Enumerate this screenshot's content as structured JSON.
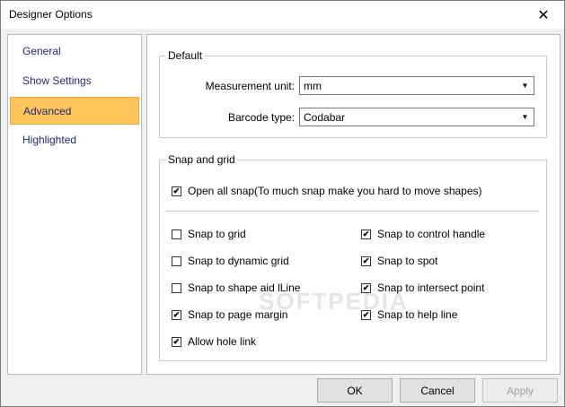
{
  "window": {
    "title": "Designer Options"
  },
  "sidebar": {
    "items": [
      {
        "label": "General",
        "active": false
      },
      {
        "label": "Show Settings",
        "active": false
      },
      {
        "label": "Advanced",
        "active": true
      },
      {
        "label": "Highlighted",
        "active": false
      }
    ]
  },
  "default_group": {
    "legend": "Default",
    "measurement_unit_label": "Measurement unit:",
    "measurement_unit_value": "mm",
    "barcode_type_label": "Barcode type:",
    "barcode_type_value": "Codabar"
  },
  "snap_group": {
    "legend": "Snap and grid",
    "watermark": "SOFTPEDIA",
    "open_all_snap": {
      "label": "Open all snap(To much snap make you hard to move shapes)",
      "checked": true
    },
    "left_options": [
      {
        "label": "Snap to grid",
        "checked": false
      },
      {
        "label": "Snap to dynamic grid",
        "checked": false
      },
      {
        "label": "Snap to shape aid lLine",
        "checked": false
      },
      {
        "label": "Snap to page margin",
        "checked": true
      },
      {
        "label": "Allow hole link",
        "checked": true
      }
    ],
    "right_options": [
      {
        "label": "Snap to control handle",
        "checked": true
      },
      {
        "label": "Snap to spot",
        "checked": true
      },
      {
        "label": "Snap to intersect point",
        "checked": true
      },
      {
        "label": "Snap to help line",
        "checked": true
      }
    ]
  },
  "buttons": {
    "ok": "OK",
    "cancel": "Cancel",
    "apply": "Apply"
  },
  "icons": {
    "close": "close-icon",
    "dropdown": "chevron-down-icon",
    "check": "check-icon"
  }
}
